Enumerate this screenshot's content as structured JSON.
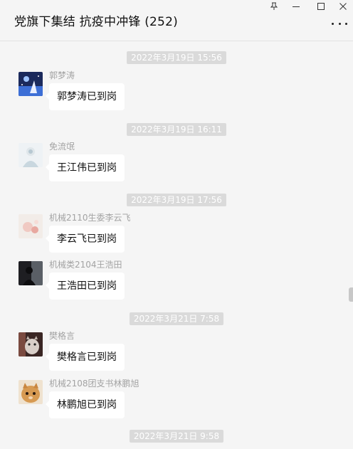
{
  "header": {
    "title": "党旗下集结  抗疫中冲锋 (252)",
    "pin_icon": "pin-icon",
    "minimize_icon": "minimize-icon",
    "maximize_icon": "maximize-icon",
    "close_icon": "close-icon",
    "more_icon": "more-icon"
  },
  "timestamps": [
    "2022年3月19日 15:56",
    "2022年3月19日 16:11",
    "2022年3月19日 17:56",
    "2022年3月21日 7:58",
    "2022年3月21日 9:58"
  ],
  "messages": [
    {
      "sender": "郭梦涛",
      "text": "郭梦涛已到岗"
    },
    {
      "sender": "免流氓",
      "text": "王江伟已到岗"
    },
    {
      "sender": "机械2110生委李云飞",
      "text": "李云飞已到岗"
    },
    {
      "sender": "机械类2104王浩田",
      "text": "王浩田已到岗"
    },
    {
      "sender": "樊格言",
      "text": "樊格言已到岗"
    },
    {
      "sender": "机械2108团支书林鹏旭",
      "text": "林鹏旭已到岗"
    }
  ],
  "colors": {
    "background": "#f5f5f5",
    "bubble": "#ffffff",
    "timestamp_bg": "#dadada",
    "sender_text": "#a3a3a3"
  }
}
